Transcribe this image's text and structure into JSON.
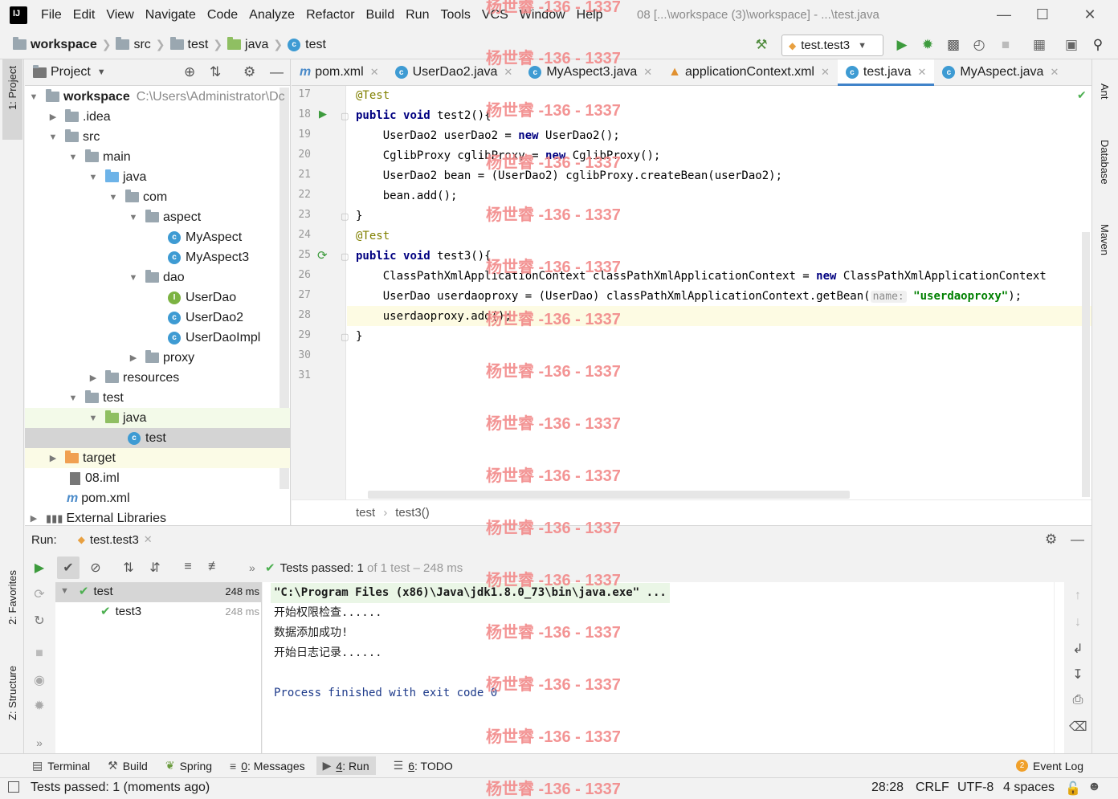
{
  "menubar": {
    "items": [
      "File",
      "Edit",
      "View",
      "Navigate",
      "Code",
      "Analyze",
      "Refactor",
      "Build",
      "Run",
      "Tools",
      "VCS",
      "Window",
      "Help"
    ],
    "window_title": "08 [...\\workspace (3)\\workspace] - ...\\test.java"
  },
  "navbar": {
    "crumbs": [
      "workspace",
      "src",
      "test",
      "java",
      "test"
    ],
    "run_config": "test.test3"
  },
  "left_strip": {
    "project_tab": "1: Project",
    "favorites_tab": "2: Favorites",
    "structure_tab": "Z: Structure"
  },
  "right_strip": {
    "ant_tab": "Ant",
    "database_tab": "Database",
    "maven_tab": "Maven"
  },
  "project_panel": {
    "title": "Project",
    "tree": [
      {
        "label": "workspace",
        "extra": "C:\\Users\\Administrator\\Dc"
      },
      {
        "label": ".idea"
      },
      {
        "label": "src"
      },
      {
        "label": "main"
      },
      {
        "label": "java"
      },
      {
        "label": "com"
      },
      {
        "label": "aspect"
      },
      {
        "label": "MyAspect"
      },
      {
        "label": "MyAspect3"
      },
      {
        "label": "dao"
      },
      {
        "label": "UserDao"
      },
      {
        "label": "UserDao2"
      },
      {
        "label": "UserDaoImpl"
      },
      {
        "label": "proxy"
      },
      {
        "label": "resources"
      },
      {
        "label": "test"
      },
      {
        "label": "java"
      },
      {
        "label": "test"
      },
      {
        "label": "target"
      },
      {
        "label": "08.iml"
      },
      {
        "label": "pom.xml"
      },
      {
        "label": "External Libraries"
      }
    ]
  },
  "editor": {
    "tabs": [
      "pom.xml",
      "UserDao2.java",
      "MyAspect3.java",
      "applicationContext.xml",
      "test.java",
      "MyAspect.java"
    ],
    "active_tab": "test.java",
    "line_numbers": [
      "17",
      "18",
      "19",
      "20",
      "21",
      "22",
      "23",
      "24",
      "25",
      "26",
      "27",
      "28",
      "29",
      "30",
      "31"
    ],
    "code": {
      "l17": "@Test",
      "l18a": "public",
      "l18b": "void",
      "l18c": " test2(){",
      "l19a": "    UserDao2 userDao2 = ",
      "l19b": "new",
      "l19c": " UserDao2();",
      "l20a": "    CglibProxy cglibProxy = ",
      "l20b": "new",
      "l20c": " CglibProxy();",
      "l21": "    UserDao2 bean = (UserDao2) cglibProxy.createBean(userDao2);",
      "l22": "    bean.add();",
      "l23": "}",
      "l24": "@Test",
      "l25a": "public",
      "l25b": "void",
      "l25c": " test3(){",
      "l26a": "    ClassPathXmlApplicationContext classPathXmlApplicationContext = ",
      "l26b": "new",
      "l26c": " ClassPathXmlApplicationContext",
      "l27a": "    UserDao userdaoproxy = (UserDao) classPathXmlApplicationContext.getBean(",
      "l27hint": "name:",
      "l27str": "\"userdaoproxy\"",
      "l27end": ");",
      "l28": "    userdaoproxy.add();",
      "l29": "}"
    },
    "breadcrumb": [
      "test",
      "test3()"
    ]
  },
  "run_panel": {
    "label": "Run:",
    "tab": "test.test3",
    "status_prefix": "Tests passed: ",
    "status_count": "1",
    "status_suffix": " of 1 test – 248 ms",
    "tests": [
      {
        "name": "test",
        "time": "248 ms"
      },
      {
        "name": "test3",
        "time": "248 ms"
      }
    ],
    "console": [
      "\"C:\\Program Files (x86)\\Java\\jdk1.8.0_73\\bin\\java.exe\" ...",
      "开始权限检查......",
      "数据添加成功!",
      "开始日志记录......",
      "",
      "Process finished with exit code 0"
    ]
  },
  "bottom_tools": {
    "terminal": "Terminal",
    "build": "Build",
    "spring": "Spring",
    "messages_key": "0",
    "messages": ": Messages",
    "run_key": "4",
    "run": ": Run",
    "todo_key": "6",
    "todo": ": TODO",
    "event_log_count": "2",
    "event_log": "Event Log"
  },
  "status_bar": {
    "message": "Tests passed: 1 (moments ago)",
    "position": "28:28",
    "line_sep": "CRLF",
    "encoding": "UTF-8",
    "indent": "4 spaces"
  },
  "watermark": "杨世睿 -136 - 1337",
  "colors": {
    "accent": "#4083c9",
    "keyword": "#000080",
    "annotation": "#808000",
    "string": "#008000",
    "pass": "#4caf50",
    "watermark": "#f28b8b"
  }
}
